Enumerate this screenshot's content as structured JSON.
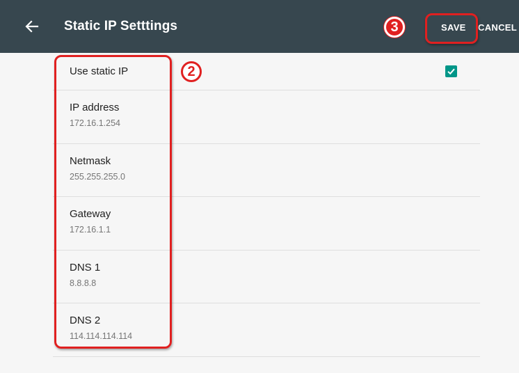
{
  "app_bar": {
    "title": "Static IP Setttings",
    "save_label": "SAVE",
    "cancel_label": "CANCEL",
    "back_icon": "arrow-left-icon"
  },
  "settings": {
    "use_static_ip": {
      "label": "Use static IP",
      "checked": true
    },
    "ip_address": {
      "label": "IP address",
      "value": "172.16.1.254"
    },
    "netmask": {
      "label": "Netmask",
      "value": "255.255.255.0"
    },
    "gateway": {
      "label": "Gateway",
      "value": "172.16.1.1"
    },
    "dns1": {
      "label": "DNS 1",
      "value": "8.8.8.8"
    },
    "dns2": {
      "label": "DNS 2",
      "value": "114.114.114.114"
    }
  },
  "annotations": {
    "step_2": "2",
    "step_3": "3"
  },
  "colors": {
    "app_bar": "#37474f",
    "accent": "#009688",
    "annotation": "#e02020",
    "background": "#f6f6f6"
  }
}
